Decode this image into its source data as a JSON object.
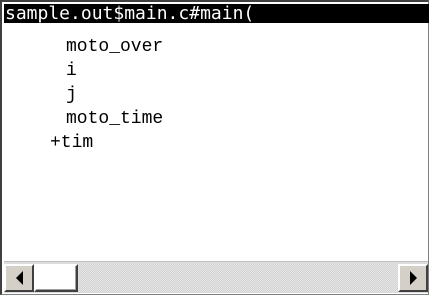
{
  "window": {
    "title": "sample.out$main.c#main("
  },
  "watch_list": {
    "items": [
      {
        "label": "moto_over"
      },
      {
        "label": "i"
      },
      {
        "label": "j"
      },
      {
        "label": "moto_time"
      },
      {
        "label": "+tim"
      }
    ]
  },
  "scrollbar": {
    "left_icon": "scroll-left-arrow-icon",
    "right_icon": "scroll-right-arrow-icon"
  }
}
